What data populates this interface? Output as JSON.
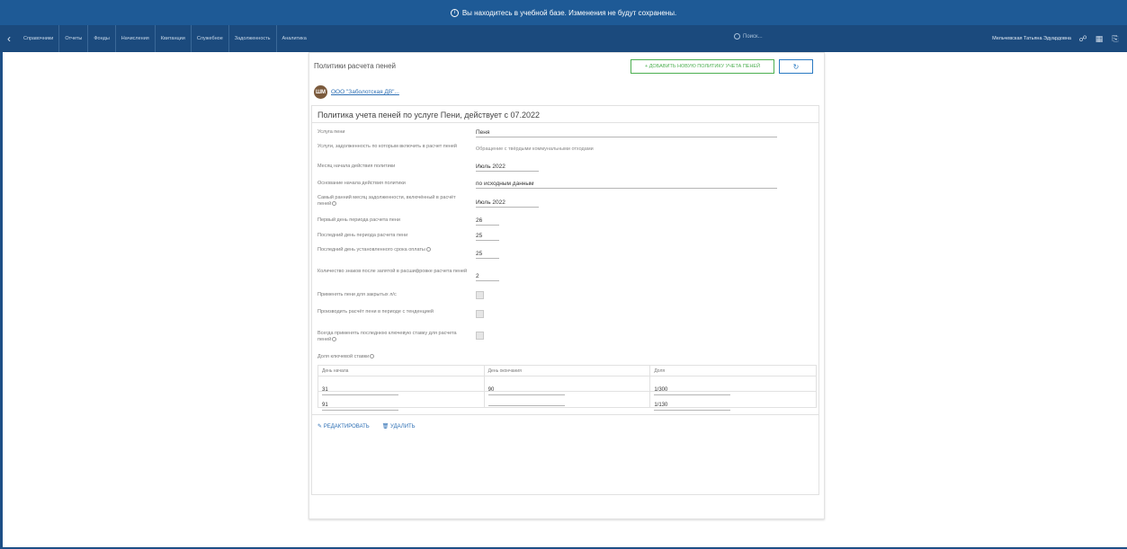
{
  "banner": {
    "text": "Вы находитесь в учебной базе. Изменения не будут сохранены."
  },
  "nav": {
    "items": [
      "Справочники",
      "Отчеты",
      "Фонды",
      "Начисления",
      "Квитанции",
      "Служебное",
      "Задолженность",
      "Аналитика"
    ],
    "search_placeholder": "Поиск...",
    "user_name": "Мельчевская Татьяна Эдуардовна"
  },
  "page": {
    "title": "Политики расчета пеней",
    "add_button": "+ ДОБАВИТЬ НОВУЮ ПОЛИТИКУ УЧЕТА ПЕНЕЙ",
    "refresh_button": "↻"
  },
  "org": {
    "avatar": "ШМ",
    "name": "ООО \"Заболотская ДВ\"..."
  },
  "policy": {
    "title": "Политика учета пеней по услуге Пени, действует с 07.2022",
    "fields": [
      {
        "label": "Услуга пени",
        "value": "Пеня"
      },
      {
        "label": "Услуги, задолженность по которым включить в расчет пеней",
        "value": "Обращение с твёрдыми коммунальными отходами"
      },
      {
        "label": "Месяц начала действия политики",
        "value": "Июль 2022"
      },
      {
        "label": "Основание начала действия политики",
        "value": "по исходным данным"
      },
      {
        "label": "Самый ранний месяц задолженности, включённый в расчёт пеней",
        "value": "Июль 2022"
      },
      {
        "label": "Первый день периода расчета пени",
        "value": "26"
      },
      {
        "label": "Последний день периода расчета пени",
        "value": "25"
      },
      {
        "label": "Последний день установленного срока оплаты",
        "value": "25"
      },
      {
        "label": "Количество знаков после запятой в расшифровке расчета пеней",
        "value": "2"
      },
      {
        "label": "Применять пени для закрытых л/с"
      },
      {
        "label": "Производить расчёт пени в периоде с тенденцией"
      },
      {
        "label": "Всегда применять последнюю ключевую ставку для расчета пеней"
      }
    ],
    "rates_label": "Доля ключевой ставки",
    "rates_headers": [
      "День начала",
      "День окончания",
      "Доля"
    ],
    "rates_rows": [
      {
        "start": "31",
        "end": "90",
        "share": "1/300"
      },
      {
        "start": "91",
        "end": "",
        "share": "1/130"
      }
    ],
    "edit_label": "РЕДАКТИРОВАТЬ",
    "delete_label": "УДАЛИТЬ"
  }
}
